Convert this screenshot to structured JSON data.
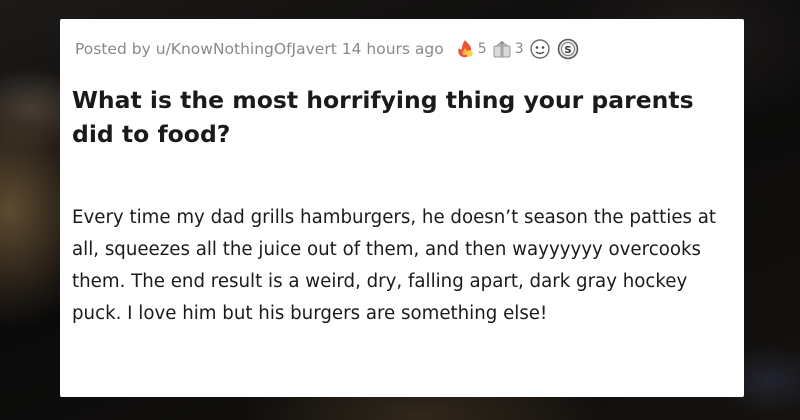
{
  "post": {
    "posted_by_prefix": "Posted by",
    "username": "u/KnowNothingOfJavert",
    "time_ago": "14 hours ago",
    "awards": [
      {
        "icon": "fire-award-icon",
        "count": "5"
      },
      {
        "icon": "gift-award-icon",
        "count": "3"
      },
      {
        "icon": "face-award-icon",
        "count": ""
      },
      {
        "icon": "coin-award-icon",
        "count": ""
      }
    ],
    "title": "What is the most horrifying thing your parents did to food?",
    "body": "Every time my dad grills hamburgers, he doesn’t season the patties at all, squeezes all the juice out of them, and then wayyyyyy overcooks them. The end result is a weird, dry, falling apart, dark gray hockey puck. I love him but his burgers are something else!"
  },
  "colors": {
    "meta_text": "#878a8c",
    "title_text": "#1a1a1b",
    "card_bg": "#ffffff"
  }
}
